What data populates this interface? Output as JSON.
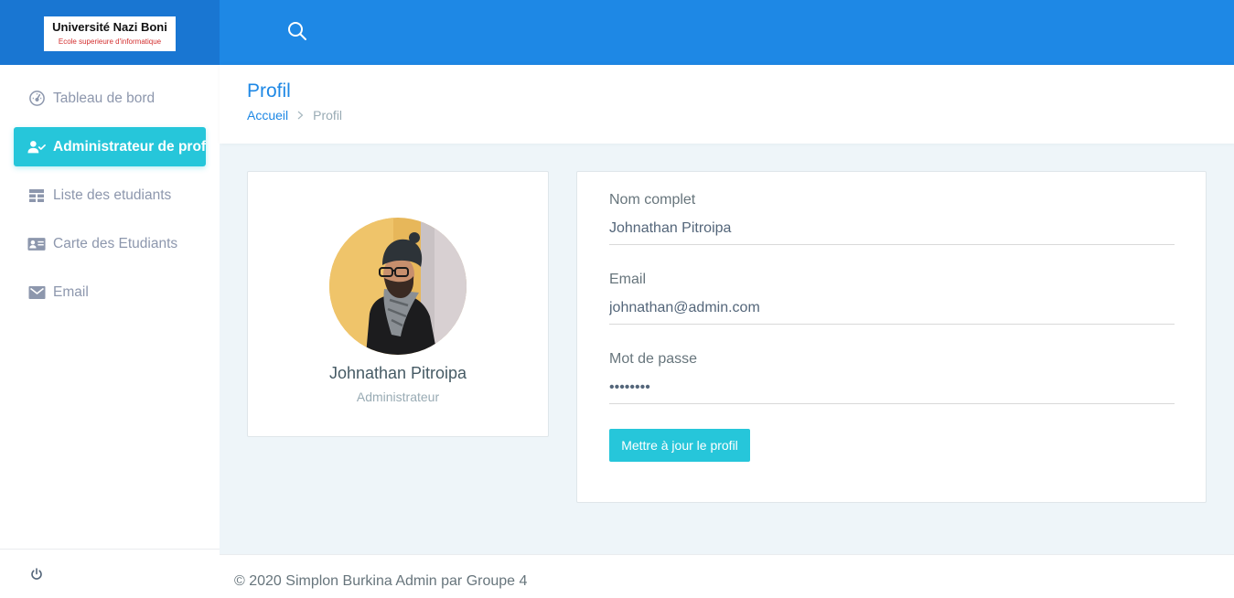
{
  "topbar": {
    "logo": {
      "title": "Université Nazi Boni",
      "subtitle": "Ecole superieure d'informatique"
    },
    "search_icon": "search-icon"
  },
  "sidebar": {
    "items": [
      {
        "label": "Tableau de bord",
        "icon": "dashboard-gauge-icon",
        "active": false
      },
      {
        "label": "Administrateur de profil",
        "icon": "user-check-icon",
        "active": true
      },
      {
        "label": "Liste des etudiants",
        "icon": "table-icon",
        "active": false
      },
      {
        "label": "Carte des Etudiants",
        "icon": "id-card-icon",
        "active": false
      },
      {
        "label": "Email",
        "icon": "mail-icon",
        "active": false
      }
    ],
    "footer_icon": "power-icon"
  },
  "page": {
    "title": "Profil",
    "breadcrumb": {
      "home": "Accueil",
      "current": "Profil"
    }
  },
  "profile_card": {
    "name": "Johnathan Pitroipa",
    "role": "Administrateur"
  },
  "form": {
    "fullname": {
      "label": "Nom complet",
      "value": "Johnathan Pitroipa"
    },
    "email": {
      "label": "Email",
      "value": "johnathan@admin.com"
    },
    "password": {
      "label": "Mot de passe",
      "value": "password"
    },
    "submit_label": "Mettre à jour le profil"
  },
  "footer": {
    "text": "© 2020 Simplon Burkina Admin par Groupe 4"
  },
  "colors": {
    "topbar": "#1e88e5",
    "brand": "#1976d2",
    "accent": "#26c6da",
    "link": "#1e88e5",
    "background": "#eef5f9"
  }
}
